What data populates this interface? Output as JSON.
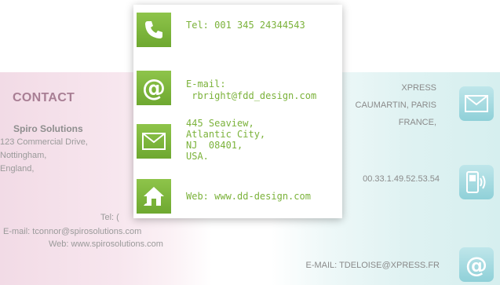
{
  "left_card": {
    "title": "CONTACT",
    "company": "Spiro Solutions",
    "address_lines": [
      "123 Commercial Drive,",
      "Nottingham,",
      "England,"
    ],
    "tel": "Tel: (",
    "email": "E-mail:  tconnor@spirosolutions.com",
    "web": "Web: www.spirosolutions.com"
  },
  "right_card": {
    "company": "XPRESS",
    "address": "CAUMARTIN, PARIS",
    "country": "FRANCE,",
    "phone": "00.33.1.49.52.53.54",
    "email": "E-MAIL:  TDELOISE@XPRESS.FR",
    "icons": [
      "envelope-icon",
      "mobile-phone-icon",
      "at-sign-icon"
    ]
  },
  "popup": {
    "tel": "Tel: 001 345 24344543",
    "email_label": "E-mail:",
    "email_value": " rbright@fdd_design.com",
    "address": "445 Seaview,\nAtlantic City,\nNJ  08401,\nUSA.",
    "web": "Web: www.dd-design.com",
    "icons": [
      "phone-icon",
      "at-sign-icon",
      "envelope-icon",
      "home-icon"
    ],
    "accent_color": "#7bb23a"
  }
}
